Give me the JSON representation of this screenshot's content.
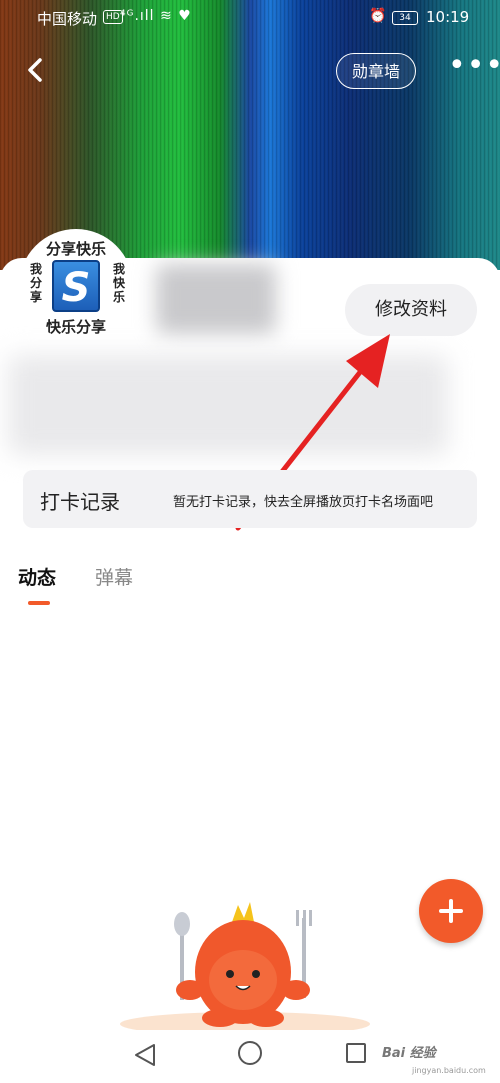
{
  "status_bar": {
    "carrier": "中国移动",
    "hd": "HD",
    "signal": "⁴ᴳ.ıll ≋ ♥",
    "battery": "34",
    "time": "10:19"
  },
  "header": {
    "medal_wall_label": "勋章墙",
    "more_label": "•••"
  },
  "avatar": {
    "top_text": "分享快乐",
    "bottom_text": "快乐分享",
    "left_text": "我分享",
    "right_text": "我快乐",
    "logo_letter": "S"
  },
  "profile": {
    "edit_label": "修改资料"
  },
  "checkin": {
    "title": "打卡记录",
    "hint": "暂无打卡记录，快去全屏播放页打卡名场面吧"
  },
  "tabs": [
    {
      "label": "动态",
      "active": true
    },
    {
      "label": "弹幕",
      "active": false
    }
  ],
  "colors": {
    "accent": "#f25a2a",
    "arrow": "#e52222"
  },
  "watermark": {
    "brand": "Bai 经验",
    "url": "jingyan.baidu.com"
  }
}
